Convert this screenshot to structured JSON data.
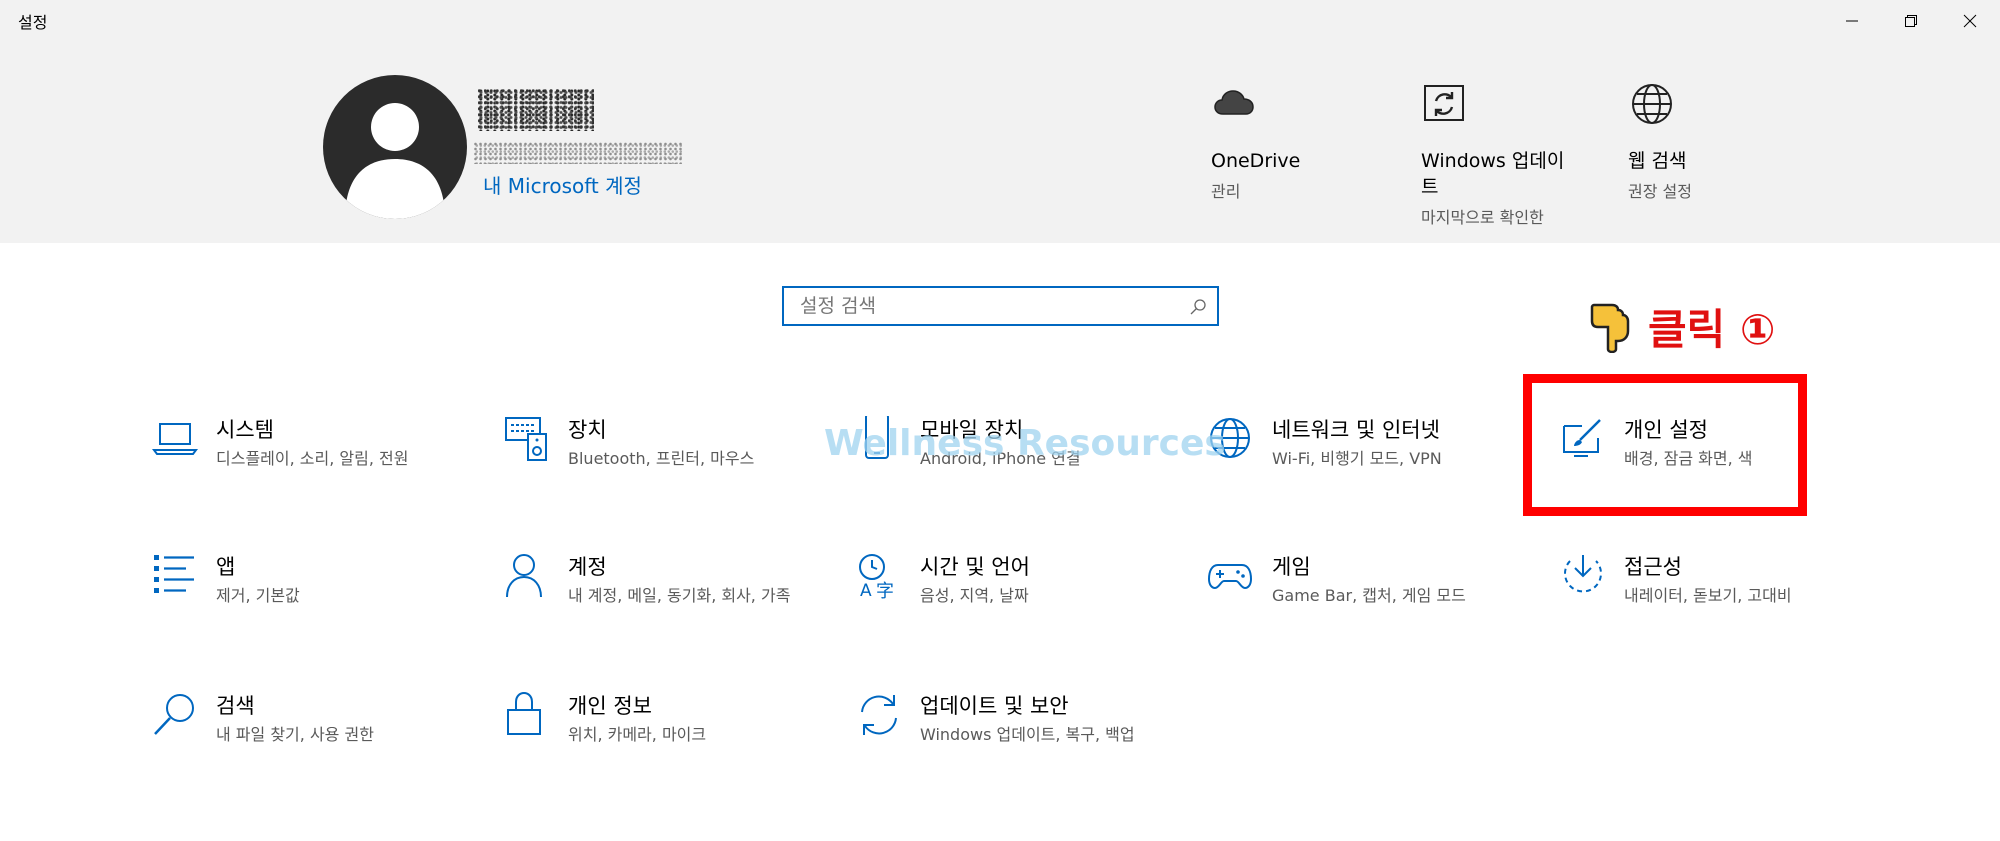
{
  "window": {
    "title": "설정",
    "minimize_icon": "minimize-icon",
    "restore_icon": "restore-icon",
    "close_icon": "close-icon"
  },
  "account": {
    "link_label": "내 Microsoft 계정"
  },
  "quick_links": [
    {
      "title": "OneDrive",
      "subtitle": "관리",
      "icon": "cloud-icon"
    },
    {
      "title": "Windows 업데이트",
      "subtitle": "마지막으로 확인한",
      "icon": "update-icon"
    },
    {
      "title": "웹 검색",
      "subtitle": "권장 설정",
      "icon": "globe-icon"
    }
  ],
  "search": {
    "placeholder": "설정 검색"
  },
  "annotation": {
    "label": "클릭 ①",
    "color": "#e01010",
    "box_color": "#ff0000"
  },
  "watermark": "Wellness Resources",
  "tiles": [
    {
      "title": "시스템",
      "subtitle": "디스플레이, 소리, 알림, 전원",
      "icon": "laptop-icon"
    },
    {
      "title": "장치",
      "subtitle": "Bluetooth, 프린터, 마우스",
      "icon": "devices-icon"
    },
    {
      "title": "모바일 장치",
      "subtitle": "Android, iPhone 연결",
      "icon": "phone-icon"
    },
    {
      "title": "네트워크 및 인터넷",
      "subtitle": "Wi-Fi, 비행기 모드, VPN",
      "icon": "network-globe-icon"
    },
    {
      "title": "개인 설정",
      "subtitle": "배경, 잠금 화면, 색",
      "icon": "personalization-icon"
    },
    {
      "title": "앱",
      "subtitle": "제거, 기본값",
      "icon": "apps-list-icon"
    },
    {
      "title": "계정",
      "subtitle": "내 계정, 메일, 동기화, 회사, 가족",
      "icon": "person-icon"
    },
    {
      "title": "시간 및 언어",
      "subtitle": "음성, 지역, 날짜",
      "icon": "time-language-icon"
    },
    {
      "title": "게임",
      "subtitle": "Game Bar, 캡처, 게임 모드",
      "icon": "gamepad-icon"
    },
    {
      "title": "접근성",
      "subtitle": "내레이터, 돋보기, 고대비",
      "icon": "accessibility-icon"
    },
    {
      "title": "검색",
      "subtitle": "내 파일 찾기, 사용 권한",
      "icon": "search-icon"
    },
    {
      "title": "개인 정보",
      "subtitle": "위치, 카메라, 마이크",
      "icon": "lock-icon"
    },
    {
      "title": "업데이트 및 보안",
      "subtitle": "Windows 업데이트, 복구, 백업",
      "icon": "sync-icon"
    }
  ],
  "colors": {
    "accent": "#0067c0",
    "header_bg": "#f2f2f2"
  }
}
